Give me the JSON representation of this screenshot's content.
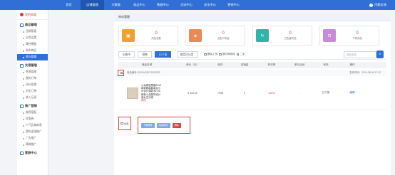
{
  "nav": [
    "首页",
    "店铺管理",
    "大数据",
    "商品中心",
    "数据中心",
    "活动中心",
    "安全中心",
    "营销中心"
  ],
  "nav_active": 1,
  "exit_label": "问题反馈",
  "sidebar": {
    "title": "我的商城",
    "groups": [
      {
        "label": "商品管理",
        "items": [
          "品牌管理",
          "分类设置",
          "属性模板",
          "发布商品",
          "库存管理"
        ]
      },
      {
        "label": "交易管理",
        "items": [
          "物流管理",
          "我的订单",
          "评价管理",
          "历史订单",
          "收入记录"
        ]
      },
      {
        "label": "推广营销",
        "items": [
          "推荐搭配",
          "优惠券",
          "人气区域商家",
          "我的返现推广",
          "广告推广",
          "满减推广"
        ]
      },
      {
        "label": "客服中心",
        "items": []
      }
    ],
    "active_item": "库存管理"
  },
  "page_title": "库存管理",
  "stats": [
    {
      "value": "0",
      "label": "商品总数",
      "color": "#f0a030",
      "icon": "bag-icon"
    },
    {
      "value": "0",
      "label": "出售中商品",
      "color": "#e78a55",
      "icon": "tag-icon"
    },
    {
      "value": "0",
      "label": "已售罄商品",
      "color": "#2fb4a8",
      "icon": "refresh-icon"
    },
    {
      "value": "0",
      "label": "下架商品",
      "color": "#c78ad6",
      "icon": "cart-icon"
    }
  ],
  "tabs": [
    "出售中",
    "预售",
    "已下架"
  ],
  "active_tab": 2,
  "select_placeholder": "按类目分类",
  "checks": [
    "删除上传",
    "按时间排序",
    "二手"
  ],
  "search_placeholder": "商品名称",
  "columns": [
    "商品名称",
    "单价（元）",
    "库存",
    "总销量",
    "好评率",
    "参与活动",
    "状态",
    "操作"
  ],
  "order": {
    "id": "商品编号:20190425170025332",
    "time": "发布时间：2019-05-06 17:32"
  },
  "product": {
    "name": "小朵家族黑鹿2019新款服装套装女小众设计感欧洲小众新款小朵服饰设计感女生礼物",
    "edit_label": "修改",
    "price": "¥ 118.00",
    "stock": "7998",
    "sales": "0",
    "rate": "100%",
    "activity": "-",
    "status": "已下架",
    "op": "编辑"
  },
  "bulk": {
    "label": "全选"
  },
  "bulk_buttons": [
    {
      "label": "下架推荐",
      "color": "#7aa8e8"
    },
    {
      "label": "批量修改",
      "color": "#7aa8e8"
    },
    {
      "label": "删除",
      "color": "#e04040"
    }
  ]
}
